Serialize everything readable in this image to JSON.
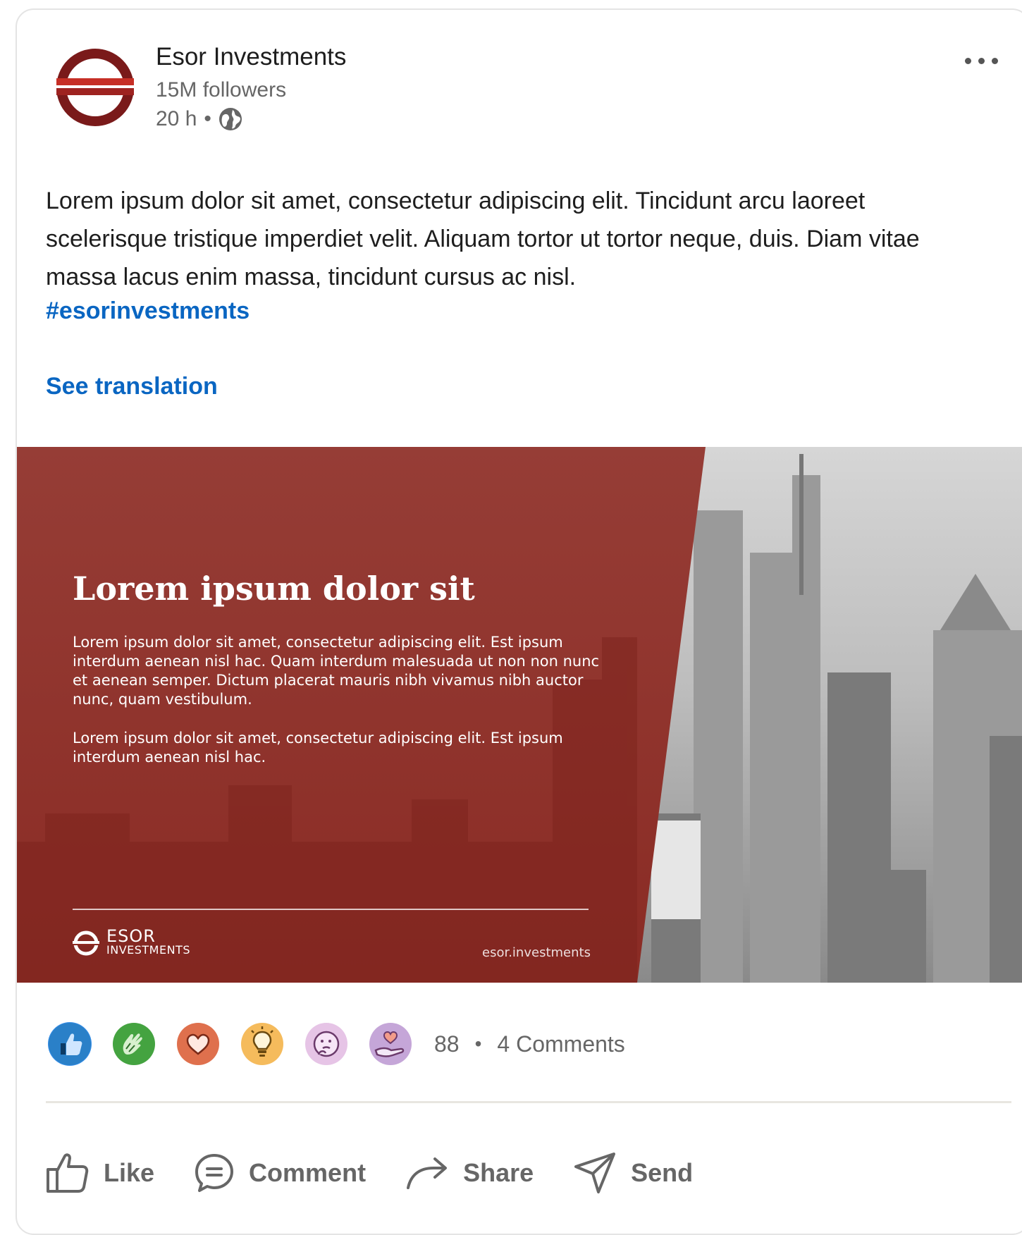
{
  "post": {
    "author": "Esor Investments",
    "followers": "15M followers",
    "time": "20 h",
    "separator": "•",
    "body": "Lorem ipsum dolor sit amet, consectetur adipiscing elit. Tincidunt arcu laoreet scelerisque tristique imperdiet velit. Aliquam tortor ut tortor neque, duis. Diam vitae massa lacus enim massa, tincidunt cursus ac nisl.",
    "hashtag": "#esorinvestments",
    "translation": "See translation"
  },
  "banner": {
    "title": "Lorem ipsum dolor sit",
    "paragraph1": "Lorem ipsum dolor sit amet, consectetur adipiscing elit. Est ipsum interdum aenean nisl hac. Quam interdum malesuada ut non non nunc et aenean semper. Dictum placerat mauris nibh vivamus nibh auctor nunc, quam vestibulum.",
    "paragraph2": "Lorem ipsum dolor sit amet, consectetur adipiscing elit. Est ipsum interdum aenean nisl hac.",
    "brand_top": "ESOR",
    "brand_bottom": "INVESTMENTS",
    "url": "esor.investments"
  },
  "reactions": {
    "icons": [
      "like-icon",
      "celebrate-icon",
      "love-icon",
      "insightful-icon",
      "curious-icon",
      "support-icon"
    ],
    "count": "88",
    "separator": "•",
    "comments": "4 Comments"
  },
  "actions": {
    "like": "Like",
    "comment": "Comment",
    "share": "Share",
    "send": "Send"
  },
  "colors": {
    "brand_red": "#8e2a22",
    "link_blue": "#0a66c2",
    "muted_text": "#666666"
  }
}
